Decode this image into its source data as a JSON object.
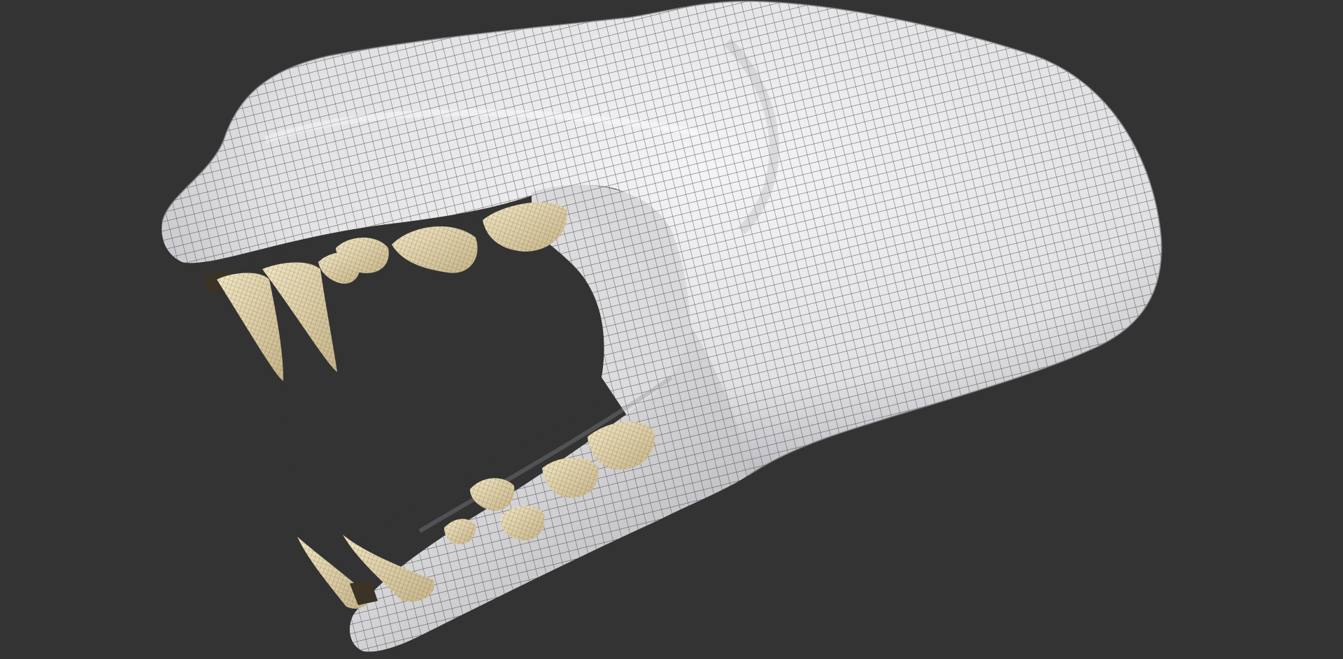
{
  "scene": {
    "subject": "skull-wireframe-model",
    "colors": {
      "background": "#333333",
      "bone": "#e8e8ea",
      "bone_shadow": "#b9b9bd",
      "wire": "#1e1e22",
      "tooth": "#e6d7ae",
      "tooth_shadow": "#8a7a52",
      "mouth_interior": "#333333"
    },
    "icons": {
      "skull": "skull-mesh-icon"
    }
  }
}
